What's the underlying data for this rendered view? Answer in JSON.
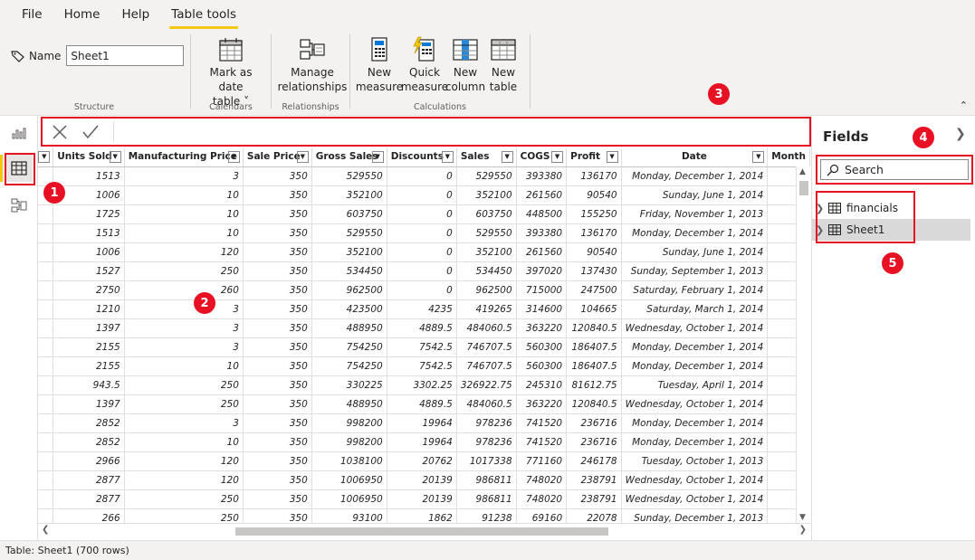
{
  "menu": {
    "tabs": [
      "File",
      "Home",
      "Help",
      "Table tools"
    ],
    "active_tab": "Table tools"
  },
  "ribbon": {
    "name_label": "Name",
    "name_value": "Sheet1",
    "groups": {
      "structure": "Structure",
      "calendars": "Calendars",
      "relationships": "Relationships",
      "calculations": "Calculations"
    },
    "buttons": {
      "mark_date_1": "Mark as date",
      "mark_date_2": "table ˅",
      "manage_1": "Manage",
      "manage_2": "relationships",
      "new_measure_1": "New",
      "new_measure_2": "measure",
      "quick_measure_1": "Quick",
      "quick_measure_2": "measure",
      "new_column_1": "New",
      "new_column_2": "column",
      "new_table_1": "New",
      "new_table_2": "table"
    }
  },
  "table": {
    "columns": [
      "",
      "Units Sold",
      "Manufacturing Price",
      "Sale Price",
      "Gross Sales",
      "Discounts",
      "Sales",
      "COGS",
      "Profit",
      "Date",
      "Month"
    ],
    "rows": [
      [
        "1513",
        "3",
        "350",
        "529550",
        "0",
        "529550",
        "393380",
        "136170",
        "Monday, December 1, 2014"
      ],
      [
        "1006",
        "10",
        "350",
        "352100",
        "0",
        "352100",
        "261560",
        "90540",
        "Sunday, June 1, 2014"
      ],
      [
        "1725",
        "10",
        "350",
        "603750",
        "0",
        "603750",
        "448500",
        "155250",
        "Friday, November 1, 2013"
      ],
      [
        "1513",
        "10",
        "350",
        "529550",
        "0",
        "529550",
        "393380",
        "136170",
        "Monday, December 1, 2014"
      ],
      [
        "1006",
        "120",
        "350",
        "352100",
        "0",
        "352100",
        "261560",
        "90540",
        "Sunday, June 1, 2014"
      ],
      [
        "1527",
        "250",
        "350",
        "534450",
        "0",
        "534450",
        "397020",
        "137430",
        "Sunday, September 1, 2013"
      ],
      [
        "2750",
        "260",
        "350",
        "962500",
        "0",
        "962500",
        "715000",
        "247500",
        "Saturday, February 1, 2014"
      ],
      [
        "1210",
        "3",
        "350",
        "423500",
        "4235",
        "419265",
        "314600",
        "104665",
        "Saturday, March 1, 2014"
      ],
      [
        "1397",
        "3",
        "350",
        "488950",
        "4889.5",
        "484060.5",
        "363220",
        "120840.5",
        "Wednesday, October 1, 2014"
      ],
      [
        "2155",
        "3",
        "350",
        "754250",
        "7542.5",
        "746707.5",
        "560300",
        "186407.5",
        "Monday, December 1, 2014"
      ],
      [
        "2155",
        "10",
        "350",
        "754250",
        "7542.5",
        "746707.5",
        "560300",
        "186407.5",
        "Monday, December 1, 2014"
      ],
      [
        "943.5",
        "250",
        "350",
        "330225",
        "3302.25",
        "326922.75",
        "245310",
        "81612.75",
        "Tuesday, April 1, 2014"
      ],
      [
        "1397",
        "250",
        "350",
        "488950",
        "4889.5",
        "484060.5",
        "363220",
        "120840.5",
        "Wednesday, October 1, 2014"
      ],
      [
        "2852",
        "3",
        "350",
        "998200",
        "19964",
        "978236",
        "741520",
        "236716",
        "Monday, December 1, 2014"
      ],
      [
        "2852",
        "10",
        "350",
        "998200",
        "19964",
        "978236",
        "741520",
        "236716",
        "Monday, December 1, 2014"
      ],
      [
        "2966",
        "120",
        "350",
        "1038100",
        "20762",
        "1017338",
        "771160",
        "246178",
        "Tuesday, October 1, 2013"
      ],
      [
        "2877",
        "120",
        "350",
        "1006950",
        "20139",
        "986811",
        "748020",
        "238791",
        "Wednesday, October 1, 2014"
      ],
      [
        "2877",
        "250",
        "350",
        "1006950",
        "20139",
        "986811",
        "748020",
        "238791",
        "Wednesday, October 1, 2014"
      ],
      [
        "266",
        "250",
        "350",
        "93100",
        "1862",
        "91238",
        "69160",
        "22078",
        "Sunday, December 1, 2013"
      ]
    ]
  },
  "fields": {
    "title": "Fields",
    "search_placeholder": "Search",
    "tables": [
      "financials",
      "Sheet1"
    ]
  },
  "callouts": [
    "1",
    "2",
    "3",
    "4",
    "5"
  ],
  "status": "Table: Sheet1 (700 rows)",
  "colors": {
    "accent": "#f2c811",
    "annotation": "#e81123"
  }
}
